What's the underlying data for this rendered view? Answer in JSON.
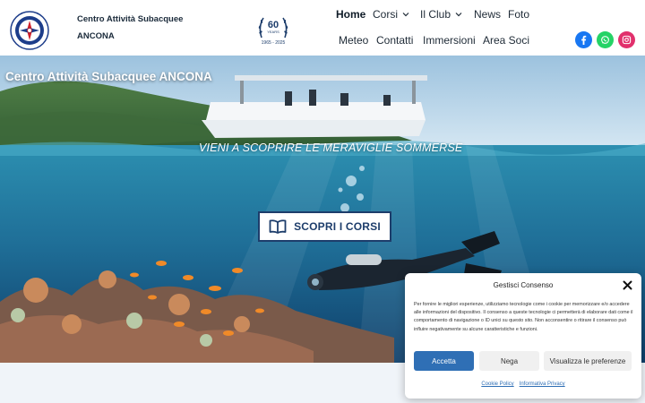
{
  "header": {
    "site_name": "Centro Attività Subacquee ANCONA",
    "logo_ring_text": "CENTRO ATTIVITÀ SUBACQUEE ANCONA",
    "anniversary_logo": {
      "years": "60",
      "caption": "YEARS",
      "range": "1965 - 2025"
    }
  },
  "nav": {
    "home": "Home",
    "corsi": "Corsi",
    "club": "Il Club",
    "news": "News",
    "foto": "Foto",
    "meteo": "Meteo",
    "contatti": "Contatti",
    "immersioni": "Immersioni",
    "area_soci": "Area Soci"
  },
  "social": [
    {
      "name": "facebook-icon",
      "color": "#1877f2"
    },
    {
      "name": "whatsapp-icon",
      "color": "#25d366"
    },
    {
      "name": "instagram-icon",
      "color": "#e1306c"
    }
  ],
  "hero": {
    "title": "Centro Attività Subacquee ANCONA",
    "tagline": "VIENI A SCOPRIRE LE MERAVIGLIE SOMMERSE",
    "cta_label": "SCOPRI I CORSI"
  },
  "cookie_banner": {
    "title": "Gestisci Consenso",
    "text": "Per fornire le migliori esperienze, utilizziamo tecnologie come i cookie per memorizzare e/o accedere alle informazioni del dispositivo. Il consenso a queste tecnologie ci permetterà di elaborare dati come il comportamento di navigazione o ID unici su questo sito. Non acconsentire o ritirare il consenso può influire negativamente su alcune caratteristiche e funzioni.",
    "accept_label": "Accetta",
    "deny_label": "Nega",
    "prefs_label": "Visualizza le preferenze",
    "cookie_policy_link": "Cookie Policy",
    "privacy_link": "Informativa Privacy",
    "accent_color": "#2f6fb5"
  }
}
